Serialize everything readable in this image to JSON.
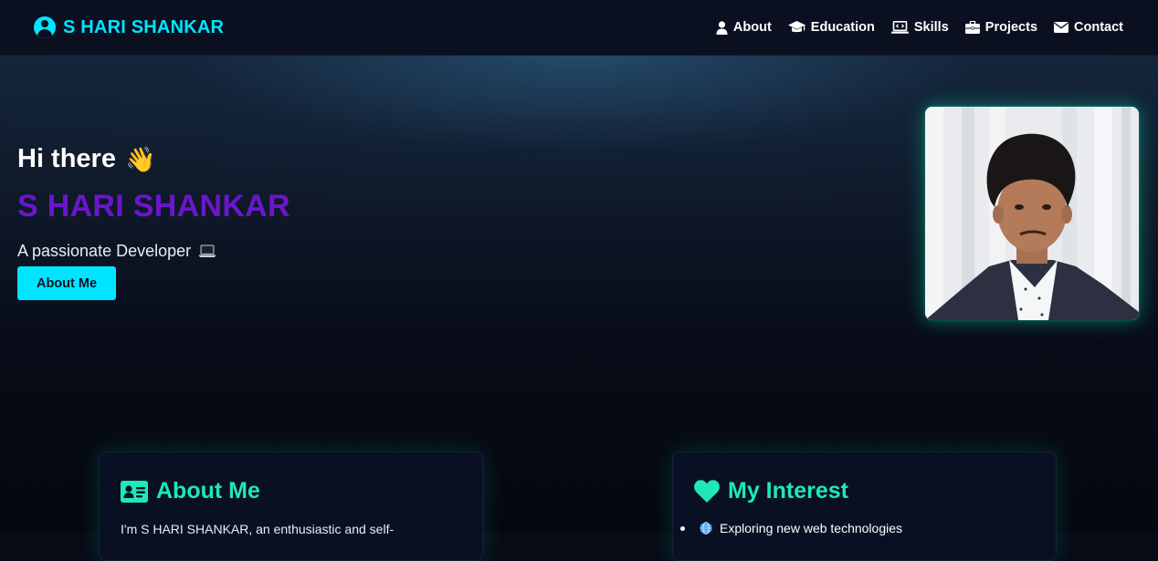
{
  "navbar": {
    "brand": "S HARI SHANKAR",
    "brand_icon": "user-circle-icon",
    "links": [
      {
        "label": "About",
        "icon": "user-icon"
      },
      {
        "label": "Education",
        "icon": "graduation-cap-icon"
      },
      {
        "label": "Skills",
        "icon": "laptop-code-icon"
      },
      {
        "label": "Projects",
        "icon": "briefcase-icon"
      },
      {
        "label": "Contact",
        "icon": "envelope-icon"
      }
    ]
  },
  "hero": {
    "greeting": "Hi there",
    "greeting_emoji": "👋",
    "name": "S HARI SHANKAR",
    "tagline": "A passionate Developer",
    "tagline_icon": "laptop-icon",
    "button_label": "About Me",
    "photo_icon": "profile-photo"
  },
  "about_card": {
    "title": "About Me",
    "icon": "id-card-icon",
    "text": "I'm S HARI SHANKAR, an enthusiastic and self-"
  },
  "interest_card": {
    "title": "My Interest",
    "icon": "heart-icon",
    "items": [
      {
        "icon": "globe-icon",
        "text": "Exploring new web technologies"
      }
    ]
  },
  "colors": {
    "accent_cyan": "#00e5ff",
    "accent_green": "#1de9b6",
    "name_purple": "#6a16cc",
    "background": "#070b16"
  }
}
